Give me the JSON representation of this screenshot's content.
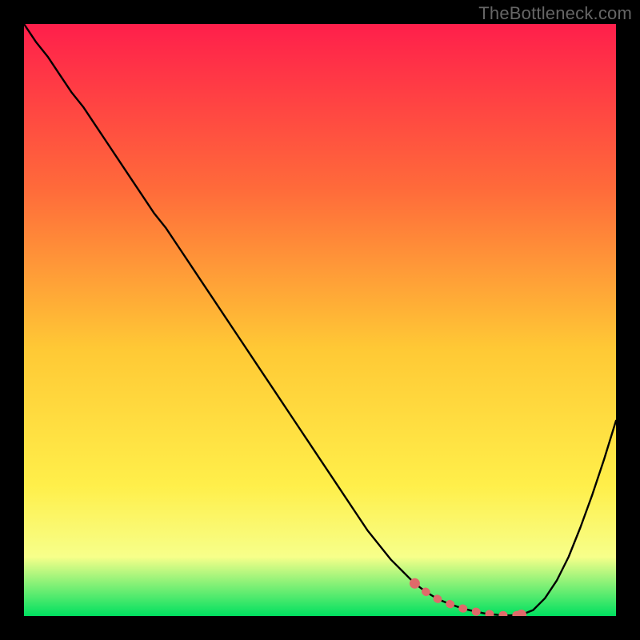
{
  "watermark": "TheBottleneck.com",
  "colors": {
    "bg": "#000000",
    "grad_top": "#ff1f4b",
    "grad_mid1": "#ff6b3a",
    "grad_mid2": "#ffc935",
    "grad_mid3": "#ffef4a",
    "grad_mid4": "#f7ff8a",
    "grad_bot": "#00e060",
    "curve": "#000000",
    "marker": "#e06a6a"
  },
  "chart_data": {
    "type": "line",
    "title": "",
    "xlabel": "",
    "ylabel": "",
    "x": [
      0.0,
      0.02,
      0.04,
      0.06,
      0.08,
      0.1,
      0.12,
      0.14,
      0.16,
      0.18,
      0.2,
      0.22,
      0.24,
      0.26,
      0.28,
      0.3,
      0.32,
      0.34,
      0.36,
      0.38,
      0.4,
      0.42,
      0.44,
      0.46,
      0.48,
      0.5,
      0.52,
      0.54,
      0.56,
      0.58,
      0.6,
      0.62,
      0.64,
      0.66,
      0.68,
      0.7,
      0.72,
      0.74,
      0.76,
      0.78,
      0.8,
      0.82,
      0.84,
      0.86,
      0.88,
      0.9,
      0.92,
      0.94,
      0.96,
      0.98,
      1.0
    ],
    "values": [
      1.0,
      0.97,
      0.945,
      0.915,
      0.885,
      0.86,
      0.83,
      0.8,
      0.77,
      0.74,
      0.71,
      0.68,
      0.655,
      0.625,
      0.595,
      0.565,
      0.535,
      0.505,
      0.475,
      0.445,
      0.415,
      0.385,
      0.355,
      0.325,
      0.295,
      0.265,
      0.235,
      0.205,
      0.175,
      0.145,
      0.12,
      0.095,
      0.075,
      0.055,
      0.04,
      0.028,
      0.02,
      0.013,
      0.008,
      0.004,
      0.002,
      0.001,
      0.002,
      0.01,
      0.03,
      0.06,
      0.1,
      0.15,
      0.205,
      0.265,
      0.33
    ],
    "xlim": [
      0,
      1
    ],
    "ylim": [
      0,
      1
    ],
    "markers": {
      "x": [
        0.66,
        0.68,
        0.7,
        0.72,
        0.74,
        0.76,
        0.78,
        0.8,
        0.82,
        0.84
      ],
      "y": [
        0.055,
        0.04,
        0.028,
        0.02,
        0.013,
        0.008,
        0.004,
        0.002,
        0.001,
        0.002
      ]
    }
  }
}
